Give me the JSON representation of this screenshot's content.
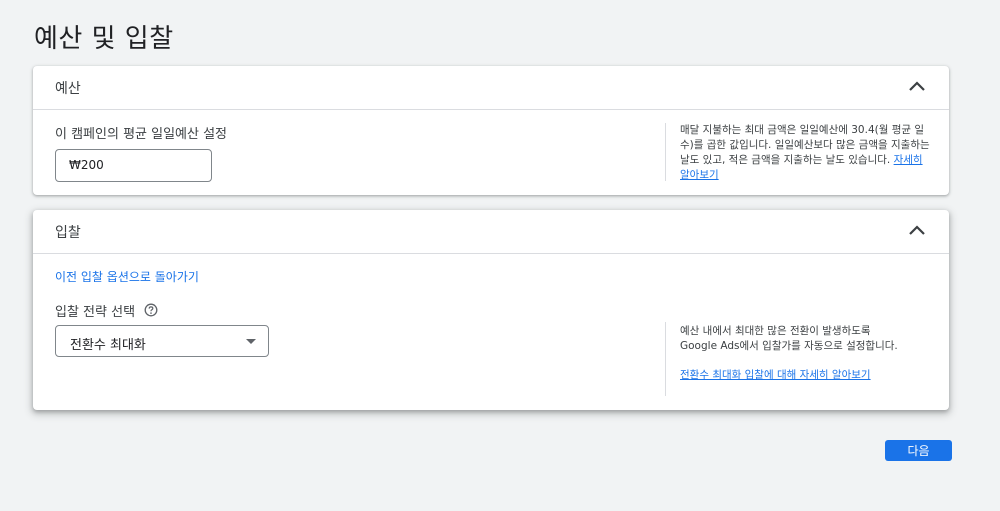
{
  "page": {
    "title": "예산 및 입찰"
  },
  "budget": {
    "section_title": "예산",
    "field_label": "이 캠페인의 평균 일일예산 설정",
    "amount_value": "₩200",
    "help_text": "매달 지불하는 최대 금액은 일일예산에 30.4(월 평균 일수)를 곱한 값입니다. 일일예산보다 많은 금액을 지출하는 날도 있고, 적은 금액을 지출하는 날도 있습니다.",
    "learn_more_link": "자세히 알아보기"
  },
  "bidding": {
    "section_title": "입찰",
    "back_link": "이전 입찰 옵션으로 돌아가기",
    "strategy_label": "입찰 전략 선택",
    "strategy_selected": "전환수 최대화",
    "help_line1": "예산 내에서 최대한 많은 전환이 발생하도록",
    "help_line2": "Google Ads에서 입찰가를 자동으로 설정합니다.",
    "learn_more_link": "전환수 최대화 입찰에 대해 자세히 알아보기"
  },
  "footer": {
    "next_label": "다음"
  },
  "colors": {
    "accent": "#1a73e8",
    "background": "#f1f3f4",
    "card": "#ffffff"
  },
  "icons": {
    "collapse": "chevron-up-icon",
    "help": "help-circle-icon",
    "dropdown": "caret-down-icon"
  }
}
